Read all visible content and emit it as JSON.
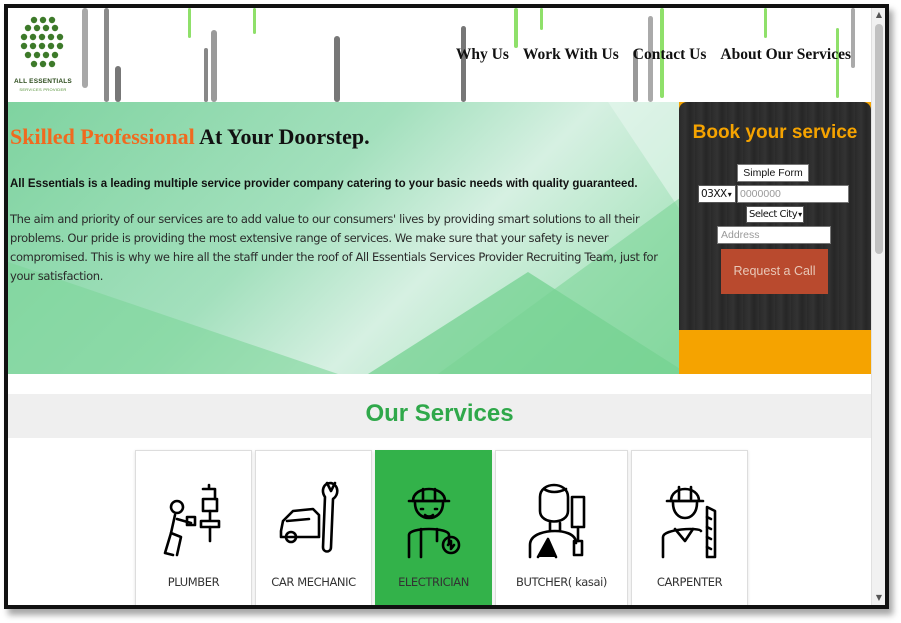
{
  "brand": {
    "name": "ALL ESSENTIALS",
    "tagline": "SERVICES PROVIDER",
    "logo_icon": "dot-cluster-logo",
    "color_green": "#2fa84a",
    "color_orange": "#f06a1f",
    "color_amber": "#f5a300"
  },
  "nav": {
    "items": [
      "Why Us",
      "Work With Us",
      "Contact Us",
      "About Our Services"
    ]
  },
  "hero": {
    "title_accent": "Skilled Professional",
    "title_rest": "At Your Doorstep.",
    "lead": "All Essentials is a leading multiple service provider company catering to your basic needs with quality guaranteed.",
    "body": "The aim and priority of our services are to add value to our consumers' lives by providing smart solutions to all their problems. Our pride is providing the most extensive range of services. We make sure that your safety is never compromised. This is why we hire all the staff under the roof of All Essentials Services Provider Recruiting Team, just for your satisfaction."
  },
  "booking": {
    "title": "Book your service",
    "form_label": "Simple Form",
    "code_value": "03XX",
    "phone_placeholder": "0000000",
    "city_value": "Select City",
    "address_placeholder": "Address",
    "button_label": "Request a Call"
  },
  "services": {
    "title": "Our Services",
    "items": [
      {
        "label": "PLUMBER",
        "icon": "plumber-icon",
        "active": false
      },
      {
        "label": "CAR MECHANIC",
        "icon": "car-mechanic-icon",
        "active": false
      },
      {
        "label": "ELECTRICIAN",
        "icon": "electrician-icon",
        "active": true
      },
      {
        "label": "BUTCHER( kasai)",
        "icon": "butcher-icon",
        "active": false
      },
      {
        "label": "CARPENTER",
        "icon": "carpenter-icon",
        "active": false
      }
    ]
  }
}
